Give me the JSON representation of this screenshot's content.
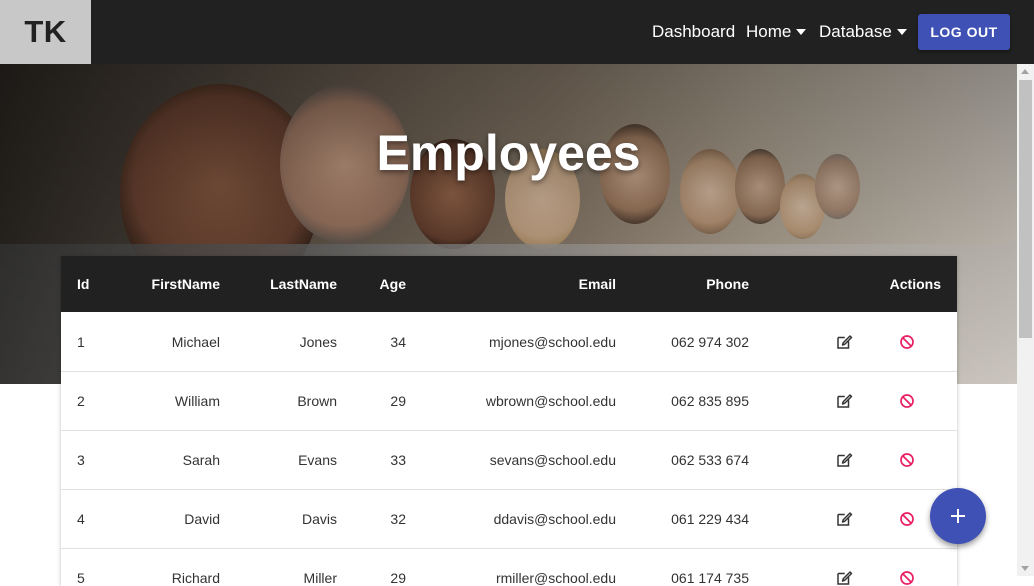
{
  "nav": {
    "logo": "TK",
    "dashboard": "Dashboard",
    "home": "Home",
    "database": "Database",
    "logout": "LOG OUT"
  },
  "hero": {
    "title": "Employees"
  },
  "table": {
    "headers": {
      "id": "Id",
      "first": "FirstName",
      "last": "LastName",
      "age": "Age",
      "email": "Email",
      "phone": "Phone",
      "actions": "Actions"
    },
    "rows": [
      {
        "id": "1",
        "first": "Michael",
        "last": "Jones",
        "age": "34",
        "email": "mjones@school.edu",
        "phone": "062 974 302"
      },
      {
        "id": "2",
        "first": "William",
        "last": "Brown",
        "age": "29",
        "email": "wbrown@school.edu",
        "phone": "062 835 895"
      },
      {
        "id": "3",
        "first": "Sarah",
        "last": "Evans",
        "age": "33",
        "email": "sevans@school.edu",
        "phone": "062 533 674"
      },
      {
        "id": "4",
        "first": "David",
        "last": "Davis",
        "age": "32",
        "email": "ddavis@school.edu",
        "phone": "061 229 434"
      },
      {
        "id": "5",
        "first": "Richard",
        "last": "Miller",
        "age": "29",
        "email": "rmiller@school.edu",
        "phone": "061 174 735"
      }
    ]
  },
  "icons": {
    "edit": "edit-icon",
    "delete": "block-icon",
    "add": "plus-icon",
    "dropdown": "caret-down-icon"
  },
  "colors": {
    "topbar": "#212121",
    "accent": "#3f51b5",
    "delete": "#e91e63",
    "logo_bg": "#c8c8c8"
  }
}
